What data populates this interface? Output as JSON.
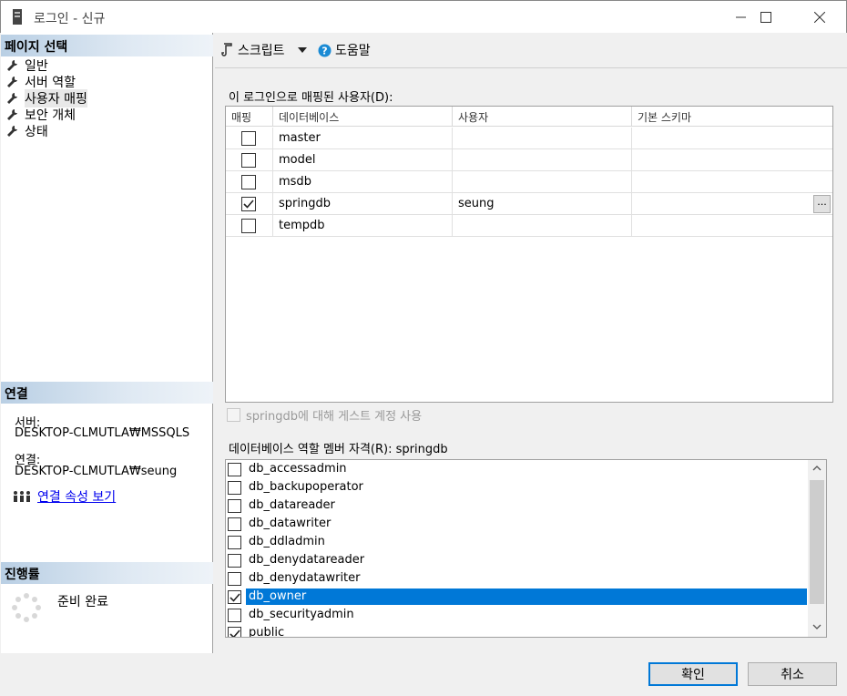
{
  "window": {
    "title": "로그인 - 신규",
    "minimize_icon": "minimize-icon",
    "maximize_icon": "maximize-icon",
    "close_icon": "close-icon"
  },
  "left": {
    "page_select_header": "페이지 선택",
    "nav_items": [
      {
        "label": "일반",
        "icon": "wrench-icon"
      },
      {
        "label": "서버 역할",
        "icon": "wrench-icon"
      },
      {
        "label": "사용자 매핑",
        "icon": "wrench-icon",
        "selected": true
      },
      {
        "label": "보안 개체",
        "icon": "wrench-icon"
      },
      {
        "label": "상태",
        "icon": "wrench-icon"
      }
    ],
    "connection_header": "연결",
    "server_label": "서버:",
    "server_value": "DESKTOP-CLMUTLA₩MSSQLS",
    "connection_label": "연결:",
    "connection_value": "DESKTOP-CLMUTLA₩seung",
    "view_properties_link": "연결 속성 보기",
    "progress_header": "진행률",
    "progress_status": "준비 완료"
  },
  "toolbar": {
    "script_label": "스크립트",
    "help_label": "도움말"
  },
  "mapping": {
    "section_label": "이 로그인으로 매핑된 사용자(D):",
    "columns": [
      "매핑",
      "데이터베이스",
      "사용자",
      "기본 스키마"
    ],
    "rows": [
      {
        "mapped": false,
        "database": "master",
        "user": "",
        "schema": ""
      },
      {
        "mapped": false,
        "database": "model",
        "user": "",
        "schema": ""
      },
      {
        "mapped": false,
        "database": "msdb",
        "user": "",
        "schema": ""
      },
      {
        "mapped": true,
        "database": "springdb",
        "user": "seung",
        "schema": ""
      },
      {
        "mapped": false,
        "database": "tempdb",
        "user": "",
        "schema": ""
      }
    ],
    "ellipsis": "..."
  },
  "guest": {
    "label": "springdb에 대해 게스트 계정 사용",
    "checked": false,
    "enabled": false
  },
  "roles": {
    "section_label": "데이터베이스 역할 멤버 자격(R): springdb",
    "items": [
      {
        "name": "db_accessadmin",
        "checked": false
      },
      {
        "name": "db_backupoperator",
        "checked": false
      },
      {
        "name": "db_datareader",
        "checked": false
      },
      {
        "name": "db_datawriter",
        "checked": false
      },
      {
        "name": "db_ddladmin",
        "checked": false
      },
      {
        "name": "db_denydatareader",
        "checked": false
      },
      {
        "name": "db_denydatawriter",
        "checked": false
      },
      {
        "name": "db_owner",
        "checked": true,
        "selected": true
      },
      {
        "name": "db_securityadmin",
        "checked": false
      },
      {
        "name": "public",
        "checked": true
      }
    ]
  },
  "buttons": {
    "ok": "확인",
    "cancel": "취소"
  },
  "colors": {
    "selection": "#0078d7",
    "link": "#0000ee",
    "header_gradient_start": "#b9cfe4"
  }
}
